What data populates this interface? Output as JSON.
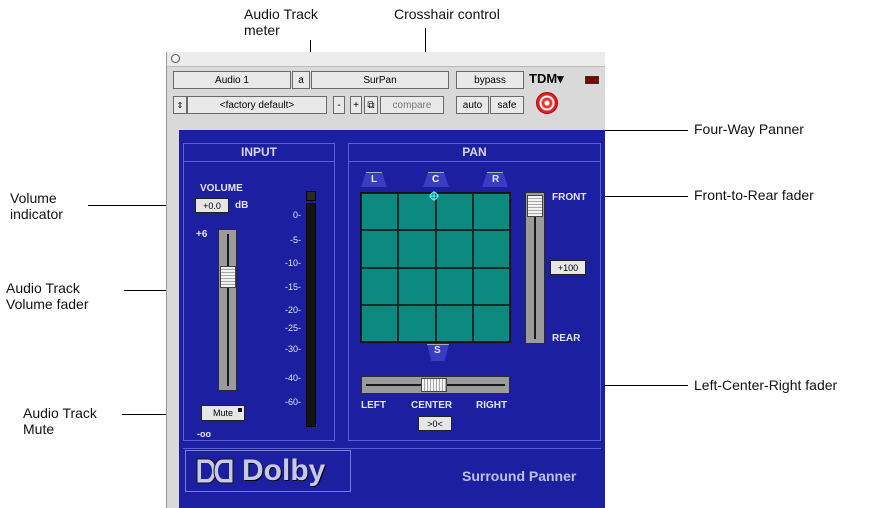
{
  "annotations": {
    "audio_track_meter": [
      "Audio Track",
      "meter"
    ],
    "crosshair_control": "Crosshair control",
    "four_way_panner": "Four-Way Panner",
    "front_to_rear_fader": "Front-to-Rear fader",
    "left_center_right_fader": "Left-Center-Right fader",
    "volume_indicator": [
      "Volume",
      "indicator"
    ],
    "audio_track_volume_fader": [
      "Audio Track",
      "Volume fader"
    ],
    "audio_track_mute": [
      "Audio Track",
      "Mute"
    ]
  },
  "header": {
    "track_name": "Audio 1",
    "channel": "a",
    "plugin_name": "SurPan",
    "bypass": "bypass",
    "format": "TDM",
    "format_arrow": "▾",
    "preset": "<factory default>",
    "minus": "-",
    "plus": "+",
    "copy_glyph": "⧉",
    "compare": "compare",
    "auto": "auto",
    "safe": "safe"
  },
  "input": {
    "title": "INPUT",
    "volume_label": "VOLUME",
    "volume_value": "+0.0",
    "volume_unit": "dB",
    "fader_top": "+6",
    "fader_bottom": "-oo",
    "mute": "Mute",
    "volume_level": 0.74,
    "meter_ticks": [
      "0-",
      "-5-",
      "-10-",
      "-15-",
      "-20-",
      "-25-",
      "-30-",
      "-40-",
      "-60-"
    ]
  },
  "pan": {
    "title": "PAN",
    "left": "L",
    "center": "C",
    "right": "R",
    "surround": "S",
    "front": "FRONT",
    "rear": "REAR",
    "front_rear_value": "+100",
    "lcr_left": "LEFT",
    "lcr_center": "CENTER",
    "lcr_right": "RIGHT",
    "lcr_value": ">0<"
  },
  "footer": {
    "brand": "Dolby",
    "product": "Surround Panner"
  },
  "colors": {
    "panel": "#1c1fa0",
    "grid": "#0c8a80"
  }
}
